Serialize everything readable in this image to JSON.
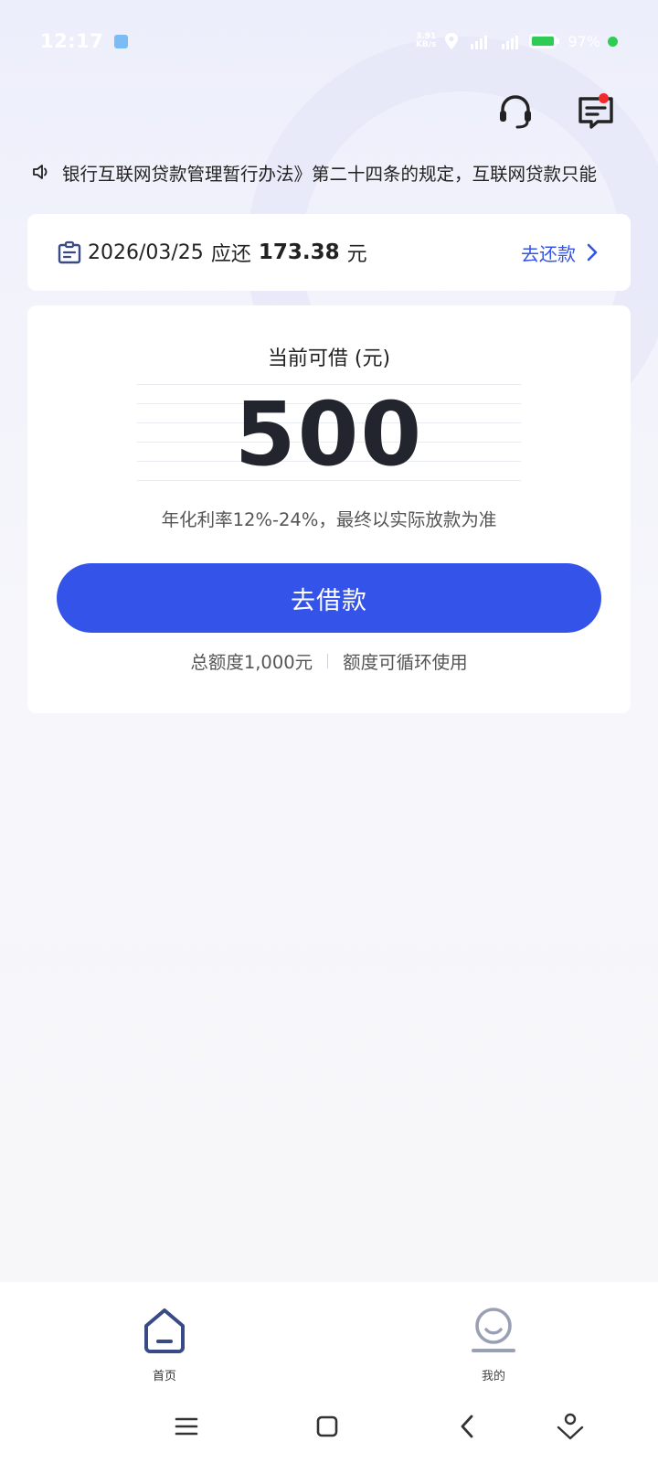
{
  "status_bar": {
    "time": "12:17",
    "net_speed_top": "3.91",
    "net_speed_bottom": "KB/s",
    "battery": "97%"
  },
  "header": {
    "icons": [
      "customer-service-icon",
      "message-icon"
    ],
    "message_badge": true
  },
  "notice": {
    "text": "银行互联网贷款管理暂行办法》第二十四条的规定，互联网贷款只能"
  },
  "repay": {
    "date": "2026/03/25",
    "due_label": "应还",
    "amount": "173.38",
    "unit": "元",
    "link_label": "去还款"
  },
  "loan": {
    "title": "当前可借 (元)",
    "amount": "500",
    "rate_text": "年化利率12%-24%，最终以实际放款为准",
    "button_label": "去借款",
    "total_quota": "总额度1,000元",
    "quota_note": "额度可循环使用"
  },
  "bottom_nav": {
    "items": [
      {
        "label": "首页",
        "icon": "home-icon",
        "active": true
      },
      {
        "label": "我的",
        "icon": "profile-icon",
        "active": false
      }
    ]
  },
  "colors": {
    "accent": "#3453e8",
    "nav_active": "#3a4a86",
    "badge": "#f02a2a"
  }
}
